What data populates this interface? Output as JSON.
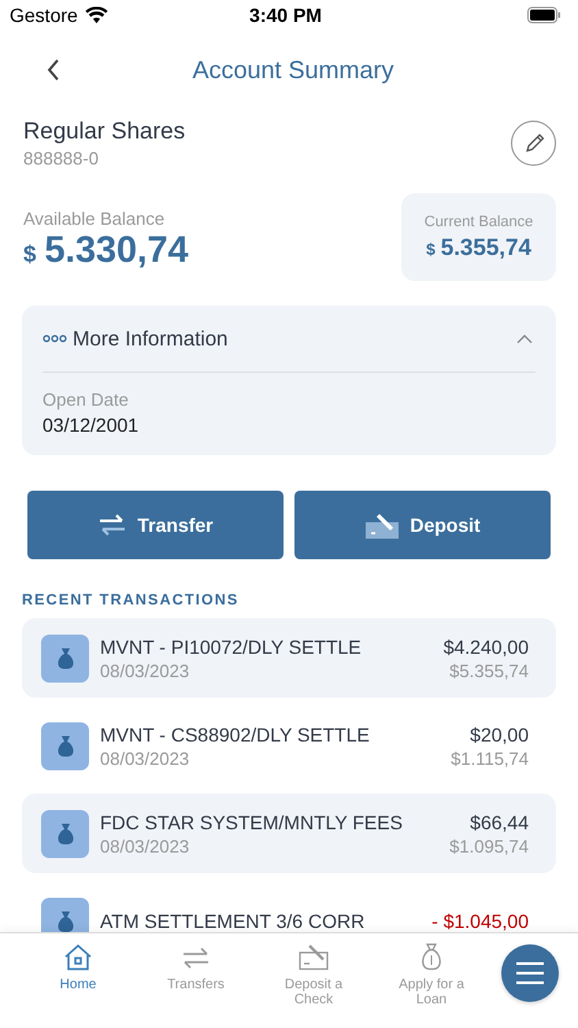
{
  "status_bar": {
    "carrier": "Gestore",
    "time": "3:40 PM"
  },
  "nav": {
    "title": "Account Summary"
  },
  "account": {
    "name": "Regular Shares",
    "number": "888888-0"
  },
  "available_balance": {
    "label": "Available Balance",
    "currency": "$",
    "amount": "5.330,74"
  },
  "current_balance": {
    "label": "Current Balance",
    "currency": "$",
    "amount": "5.355,74"
  },
  "more_information": {
    "title": "More Information",
    "expanded": true,
    "fields": [
      {
        "label": "Open Date",
        "value": "03/12/2001"
      }
    ]
  },
  "actions": [
    {
      "kind": "transfer",
      "label": "Transfer"
    },
    {
      "kind": "deposit",
      "label": "Deposit"
    }
  ],
  "recent_transactions": {
    "heading": "RECENT TRANSACTIONS",
    "items": [
      {
        "description": "MVNT - PI10072/DLY SETTLE",
        "date": "08/03/2023",
        "amount": "$4.240,00",
        "balance": "$5.355,74",
        "kind": "credit"
      },
      {
        "description": "MVNT - CS88902/DLY SETTLE",
        "date": "08/03/2023",
        "amount": "$20,00",
        "balance": "$1.115,74",
        "kind": "credit"
      },
      {
        "description": "FDC STAR SYSTEM/MNTLY FEES",
        "date": "08/03/2023",
        "amount": "$66,44",
        "balance": "$1.095,74",
        "kind": "credit"
      },
      {
        "description": "ATM SETTLEMENT 3/6 CORR",
        "amount": "- $1.045,00",
        "kind": "debit"
      }
    ]
  },
  "tab_bar": {
    "items": [
      {
        "kind": "home",
        "label": "Home",
        "selected": true
      },
      {
        "kind": "transfers",
        "label": "Transfers",
        "selected": false
      },
      {
        "kind": "deposit",
        "label": "Deposit a Check",
        "selected": false
      },
      {
        "kind": "loan",
        "label": "Apply for a Loan",
        "selected": false
      }
    ]
  }
}
